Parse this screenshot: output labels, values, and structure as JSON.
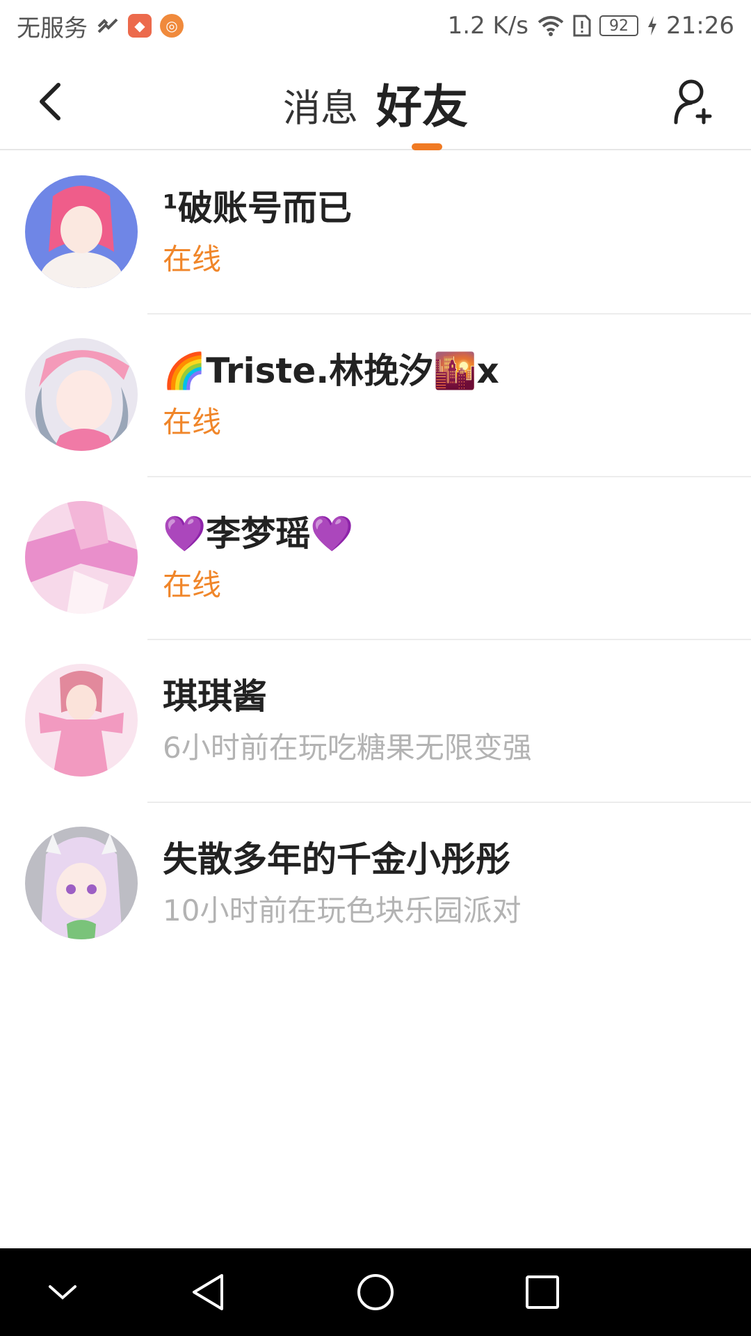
{
  "status_bar": {
    "carrier": "无服务",
    "speed": "1.2 K/s",
    "battery": "92",
    "time": "21:26"
  },
  "header": {
    "tabs": [
      {
        "label": "消息",
        "active": false
      },
      {
        "label": "好友",
        "active": true
      }
    ],
    "accent_color": "#f07a23"
  },
  "friends": [
    {
      "name": "¹破账号而已",
      "status": "在线",
      "online": true
    },
    {
      "name": "🌈Triste.林挽汐🌇x",
      "status": "在线",
      "online": true
    },
    {
      "name": "💜李梦瑶💜",
      "status": "在线",
      "online": true
    },
    {
      "name": "琪琪酱",
      "status": "6小时前在玩吃糖果无限变强",
      "online": false
    },
    {
      "name": "失散多年的千金小彤彤",
      "status": "10小时前在玩色块乐园派对",
      "online": false
    }
  ],
  "colors": {
    "online": "#f0862a",
    "offline": "#b3b3b3",
    "divider": "#ececec"
  },
  "icons": {
    "back": "chevron-left-icon",
    "add_friend": "add-user-icon",
    "nav": [
      "chevron-down-icon",
      "back-triangle-icon",
      "home-circle-icon",
      "recents-square-icon"
    ]
  }
}
